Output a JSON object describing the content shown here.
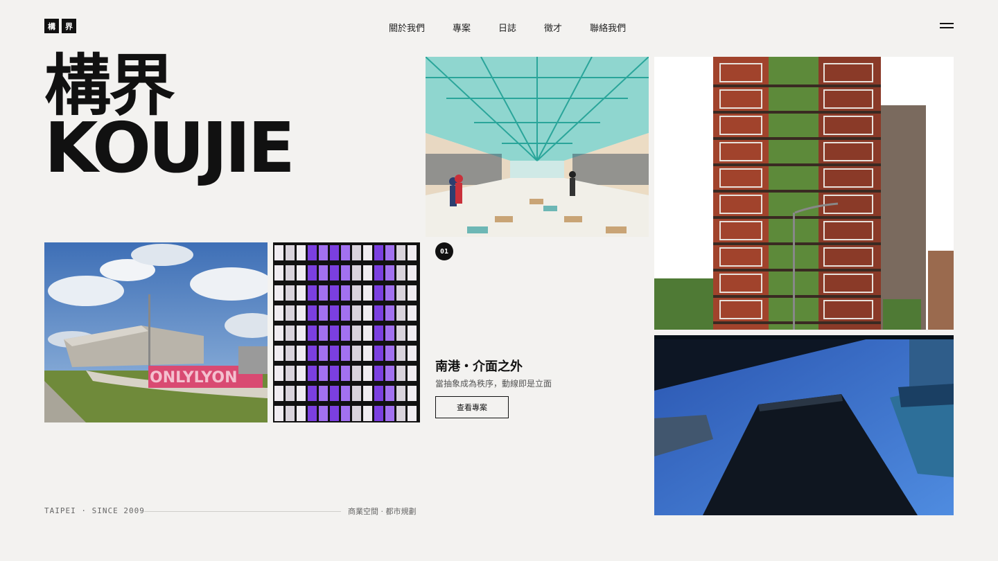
{
  "logo": {
    "char1": "構",
    "char2": "界"
  },
  "nav": {
    "about": "關於我們",
    "projects": "專案",
    "journal": "日誌",
    "careers": "徵才",
    "contact": "聯絡我們"
  },
  "menu_icon": "hamburger-icon",
  "hero": {
    "title_cn": "構界",
    "title_en": "KOUJIE"
  },
  "project": {
    "index": "01",
    "title": "南港・介面之外",
    "subtitle": "當抽象成為秩序，動線即是立面",
    "cta": "查看專案"
  },
  "footer": {
    "location": "TAIPEI · SINCE 2009",
    "services": "商業空間 · 都市規劃"
  },
  "images": {
    "lyon": "OnlyLyon sign and museum",
    "facade": "purple lit facade",
    "mall": "glass roof shopping arcade",
    "tower": "green wall tower",
    "sky": "skyscrapers looking up"
  },
  "colors": {
    "background": "#f3f2f0",
    "text": "#111111",
    "muted": "#666666"
  }
}
